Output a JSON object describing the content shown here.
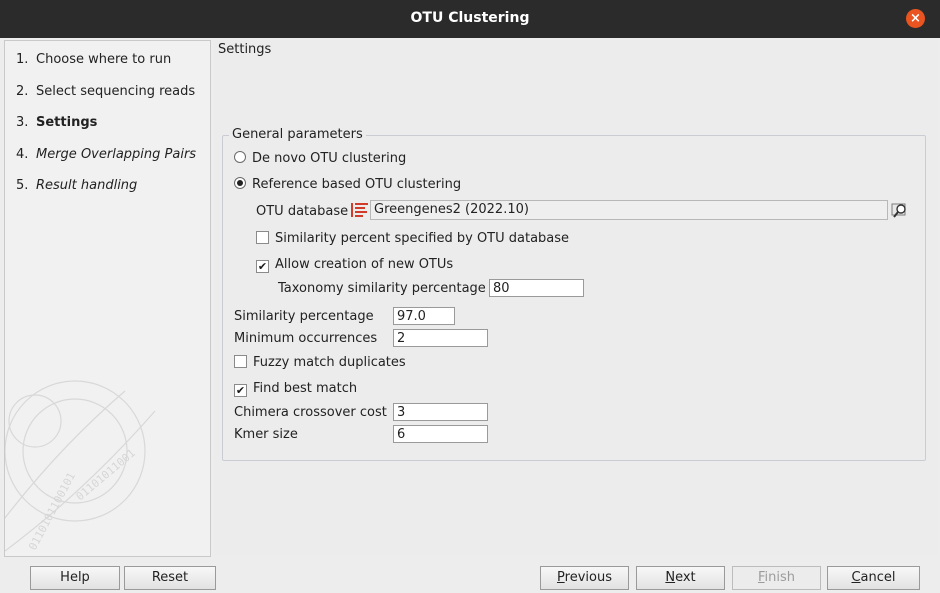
{
  "window": {
    "title": "OTU Clustering",
    "close_glyph": "×"
  },
  "steps": [
    {
      "num": "1.",
      "label": "Choose where to run"
    },
    {
      "num": "2.",
      "label": "Select sequencing reads"
    },
    {
      "num": "3.",
      "label": "Settings"
    },
    {
      "num": "4.",
      "label": "Merge Overlapping Pairs"
    },
    {
      "num": "5.",
      "label": "Result handling"
    }
  ],
  "page_title": "Settings",
  "general": {
    "legend": "General parameters",
    "de_novo_label": "De novo OTU clustering",
    "reference_label": "Reference based OTU clustering",
    "clustering_mode": "reference",
    "otu_db_label": "OTU database",
    "otu_db_value": "Greengenes2 (2022.10)",
    "similarity_by_db_label": "Similarity percent specified by OTU database",
    "similarity_by_db_checked": false,
    "allow_new_label": "Allow creation of new OTUs",
    "allow_new_checked": true,
    "taxonomy_label": "Taxonomy similarity percentage",
    "taxonomy_value": "80",
    "similarity_label": "Similarity percentage",
    "similarity_value": "97.0",
    "min_occ_label": "Minimum occurrences",
    "min_occ_value": "2",
    "fuzzy_label": "Fuzzy match duplicates",
    "fuzzy_checked": false,
    "best_match_label": "Find best match",
    "best_match_checked": true,
    "chimera_label": "Chimera crossover cost",
    "chimera_value": "3",
    "kmer_label": "Kmer size",
    "kmer_value": "6",
    "check_glyph": "✔"
  },
  "buttons": {
    "help": "Help",
    "reset": "Reset",
    "previous_mnemonic": "P",
    "previous_rest": "revious",
    "next_mnemonic": "N",
    "next_rest": "ext",
    "finish_mnemonic": "F",
    "finish_rest": "inish",
    "cancel_mnemonic": "C",
    "cancel_rest": "ancel"
  },
  "colors": {
    "titlebar": "#2b2b2b",
    "close": "#e95420",
    "db_icon": "#d23a2a"
  }
}
